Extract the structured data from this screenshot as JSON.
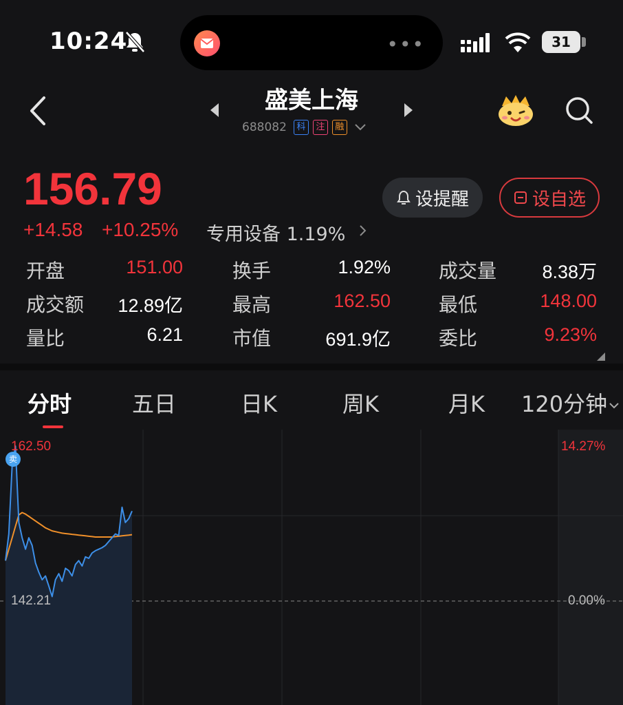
{
  "status": {
    "time": "10:24",
    "battery": "31"
  },
  "header": {
    "name": "盛美上海",
    "code": "688082",
    "tags": [
      "科",
      "注",
      "融"
    ]
  },
  "quote": {
    "price": "156.79",
    "change": "+14.58",
    "change_pct": "+10.25%",
    "sector": "专用设备 1.19%",
    "alert_label": "设提醒",
    "watch_label": "设自选"
  },
  "stats": [
    {
      "label": "开盘",
      "value": "151.00"
    },
    {
      "label": "换手",
      "value": "1.92%"
    },
    {
      "label": "成交量",
      "value": "8.38万"
    },
    {
      "label": "成交额",
      "value": "12.89亿"
    },
    {
      "label": "最高",
      "value": "162.50"
    },
    {
      "label": "最低",
      "value": "148.00"
    },
    {
      "label": "量比",
      "value": "6.21"
    },
    {
      "label": "市值",
      "value": "691.9亿"
    },
    {
      "label": "委比",
      "value": "9.23%"
    }
  ],
  "tabs": [
    "分时",
    "五日",
    "日K",
    "周K",
    "月K",
    "120分钟"
  ],
  "chart": {
    "high_label": "162.50",
    "low_label": "142.21",
    "pct_high_label": "14.27%",
    "pct_zero_label": "0.00%",
    "sell_marker": "卖"
  },
  "colors": {
    "up": "#f2343b",
    "price_line": "#3d8fe8",
    "avg_line": "#f0902a",
    "background": "#141416"
  },
  "chart_data": {
    "type": "line",
    "ylim": [
      142.21,
      162.5
    ],
    "series": [
      {
        "values": [
          147.5,
          151.0,
          160.0,
          162.5,
          152.5,
          150.5,
          149.0,
          150.5,
          149.5,
          147.2,
          146.0,
          145.0,
          145.5,
          144.2,
          142.8,
          145.0,
          145.8,
          144.8,
          146.5,
          146.2,
          145.5,
          147.0,
          147.5,
          146.8,
          148.0,
          147.8,
          148.5,
          148.8,
          149.0,
          149.2,
          149.5,
          150.0,
          150.5,
          151.0,
          150.8,
          154.5,
          152.5,
          153.0,
          154.0
        ]
      },
      {
        "values": [
          147.5,
          149.0,
          150.5,
          152.0,
          153.5,
          153.8,
          153.6,
          153.3,
          153.0,
          152.7,
          152.4,
          152.1,
          151.8,
          151.6,
          151.4,
          151.3,
          151.2,
          151.1,
          151.05,
          151.0,
          150.95,
          150.9,
          150.85,
          150.8,
          150.75,
          150.7,
          150.65,
          150.6,
          150.6,
          150.6,
          150.6,
          150.6,
          150.6,
          150.65,
          150.7,
          150.75,
          150.8,
          150.85,
          150.9
        ]
      }
    ]
  }
}
